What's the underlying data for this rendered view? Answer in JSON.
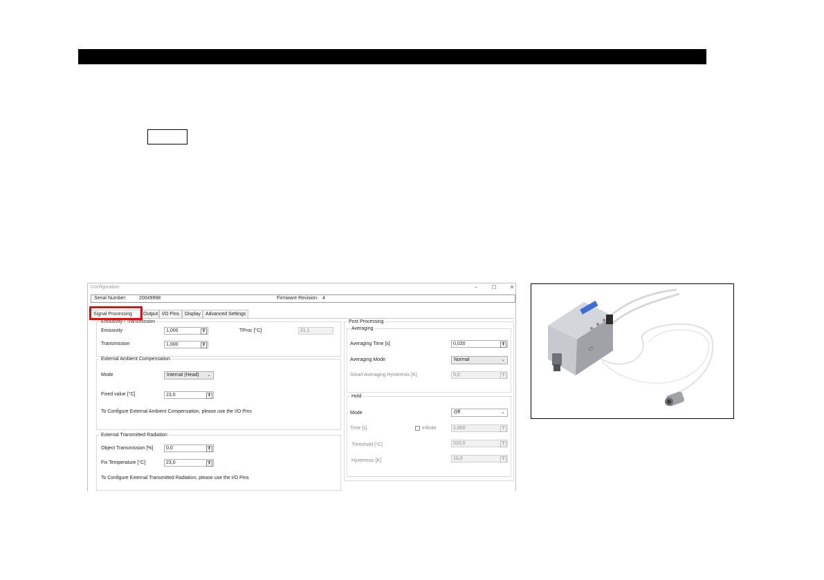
{
  "window": {
    "title": "Configuration",
    "controls": {
      "minimize": "–",
      "maximize": "☐",
      "close": "✕"
    },
    "serial_label": "Serial Number:",
    "serial_value": "20049998",
    "firmware_label": "Firmware Revision:",
    "firmware_value": "4"
  },
  "tabs": [
    "Signal Processing",
    "Output",
    "I/O Pins",
    "Display",
    "Advanced Settings"
  ],
  "highlight_color": "#e01010",
  "emissivity": {
    "legend": "Emissivity / Transmission",
    "emissivity_label": "Emissivity",
    "emissivity_value": "1,000",
    "transmission_label": "Transmission",
    "transmission_value": "1,000",
    "tproc_label": "TProc [°C]",
    "tproc_value": "21,1"
  },
  "ambient": {
    "legend": "External Ambient Compensation",
    "mode_label": "Mode",
    "mode_value": "Internal (Head)",
    "fixed_label": "Fixed value [°C]",
    "fixed_value": "23,0",
    "note": "To Configure External Ambient Compensation, please use the I/O Pins"
  },
  "transmitted": {
    "legend": "External Transmitted Radiation",
    "object_label": "Object Transmission [%]",
    "object_value": "0,0",
    "fix_label": "Fix Temperature [°C]",
    "fix_value": "23,0",
    "note": "To Configure External Transmitted Radiation, please use the I/O Pins"
  },
  "post": {
    "legend": "Post Processing",
    "averaging_legend": "Averaging",
    "avg_time_label": "Averaging Time [s]",
    "avg_time_value": "0,020",
    "avg_mode_label": "Averaging Mode",
    "avg_mode_value": "Normal",
    "smart_label": "Smart Averaging Hysteresis [K]",
    "smart_value": "5,0",
    "hold_legend": "Hold",
    "hold_mode_label": "Mode",
    "hold_mode_value": "Off",
    "time_label": "Time [s]",
    "infinite_label": "Infinite",
    "time_value": "1,000",
    "threshold_label": "Threshold [°C]",
    "threshold_value": "510,0",
    "hysteresis_label": "Hysteresis [K]",
    "hysteresis_value": "10,0"
  },
  "product_photo": {
    "label_main": "CT",
    "icon": "sensor-device-photo"
  }
}
